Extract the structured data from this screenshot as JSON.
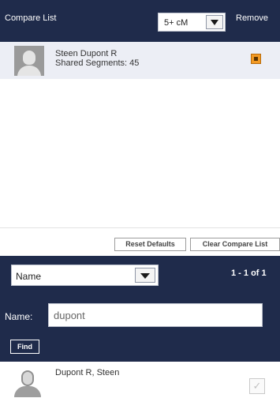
{
  "compare": {
    "title": "Compare List",
    "threshold": {
      "selected": "5+ cM"
    },
    "remove_label": "Remove",
    "items": [
      {
        "name": "Steen Dupont R",
        "segments_text": "Shared Segments: 45"
      }
    ],
    "reset_label": "Reset Defaults",
    "clear_label": "Clear Compare List"
  },
  "search": {
    "sort": {
      "selected": "Name"
    },
    "count_text": "1 - 1 of 1",
    "name_label": "Name:",
    "name_value": "dupont",
    "find_label": "Find",
    "results": [
      {
        "name": "Dupont R, Steen",
        "checked": true
      }
    ]
  },
  "icons": {
    "avatar": "user-avatar-icon",
    "dropdown": "chevron-down-icon",
    "remove": "remove-checkbox-icon",
    "check": "checkmark-icon"
  },
  "colors": {
    "header": "#1f2b4b",
    "row_highlight": "#eceef5",
    "remove_accent": "#f39a24"
  }
}
